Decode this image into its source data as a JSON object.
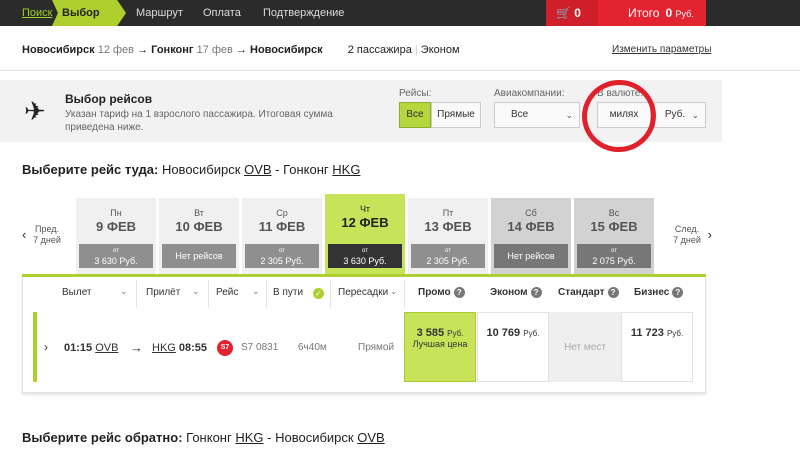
{
  "nav": {
    "steps": [
      "Поиск",
      "Выбор",
      "Маршрут",
      "Оплата",
      "Подтверждение"
    ],
    "cart_count": "0",
    "total_label": "Итого",
    "total_value": "0",
    "total_currency": "Руб."
  },
  "route": {
    "from": "Новосибирск",
    "from_date": "12 фев",
    "via": "Гонконг",
    "via_date": "17 фев",
    "to": "Новосибирск",
    "passengers": "2 пассажира",
    "class": "Эконом",
    "change_link": "Изменить параметры"
  },
  "filters": {
    "title": "Выбор рейсов",
    "description": "Указан тариф на 1 взрослого пассажира. Итоговая сумма приведена ниже.",
    "flights_label": "Рейсы:",
    "all_label": "Все",
    "direct_label": "Прямые",
    "airlines_label": "Авиакомпании:",
    "airlines_value": "Все",
    "currency_label": "В валюте:",
    "miles_label": "милях",
    "currency_value": "Руб."
  },
  "outbound": {
    "prefix": "Выберите рейс туда:",
    "from": "Новосибирск",
    "from_code": "OVB",
    "to": "Гонконг",
    "to_code": "HKG"
  },
  "days_nav": {
    "prev_line1": "Пред.",
    "prev_line2": "7 дней",
    "next_line1": "След.",
    "next_line2": "7 дней"
  },
  "days": [
    {
      "dow": "Пн",
      "date": "9 ФЕВ",
      "ot": "от",
      "price": "3 630 Руб."
    },
    {
      "dow": "Вт",
      "date": "10 ФЕВ",
      "ot": "",
      "price": "Нет рейсов"
    },
    {
      "dow": "Ср",
      "date": "11 ФЕВ",
      "ot": "от",
      "price": "2 305 Руб."
    },
    {
      "dow": "Чт",
      "date": "12 ФЕВ",
      "ot": "от",
      "price": "3 630 Руб."
    },
    {
      "dow": "Пт",
      "date": "13 ФЕВ",
      "ot": "от",
      "price": "2 305 Руб."
    },
    {
      "dow": "Сб",
      "date": "14 ФЕВ",
      "ot": "",
      "price": "Нет рейсов"
    },
    {
      "dow": "Вс",
      "date": "15 ФЕВ",
      "ot": "от",
      "price": "2 075 Руб."
    }
  ],
  "table": {
    "headers": [
      "Вылет",
      "Прилёт",
      "Рейс",
      "В пути",
      "Пересадки",
      "Промо",
      "Эконом",
      "Стандарт",
      "Бизнес"
    ]
  },
  "flight": {
    "dep_time": "01:15",
    "dep_code": "OVB",
    "arr_code": "HKG",
    "arr_time": "08:55",
    "airline_logo": "S7",
    "flight_no": "S7 0831",
    "duration": "6ч40м",
    "stops": "Прямой",
    "promo_price": "3 585",
    "promo_currency": "Руб.",
    "promo_note": "Лучшая цена",
    "econ_price": "10 769",
    "econ_currency": "Руб.",
    "standard": "Нет мест",
    "biz_price": "11 723",
    "biz_currency": "Руб."
  },
  "inbound": {
    "prefix": "Выберите рейс обратно:",
    "from": "Гонконг",
    "from_code": "HKG",
    "to": "Новосибирск",
    "to_code": "OVB"
  }
}
